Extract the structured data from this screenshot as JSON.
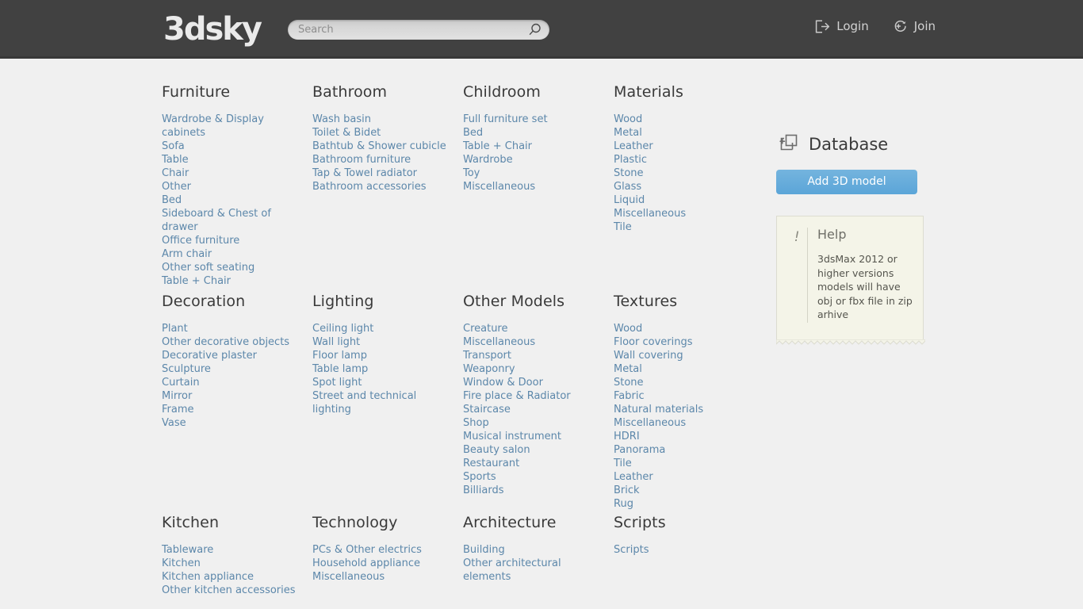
{
  "header": {
    "logo": "3dsky",
    "search": {
      "placeholder": "Search",
      "value": "",
      "icon": "search-icon"
    },
    "auth": [
      {
        "label": "Login",
        "icon": "login-arrow-icon"
      },
      {
        "label": "Join",
        "icon": "join-circle-plus-icon"
      }
    ]
  },
  "sidebar": {
    "database_title": "Database",
    "database_icon": "copy-plus-icon",
    "add_model_label": "Add 3D model",
    "help": {
      "bang": "!",
      "title": "Help",
      "text": "3dsMax 2012 or higher versions models will have obj or fbx file in zip arhive"
    }
  },
  "colors": {
    "header_bg": "#414141",
    "page_bg": "#f0f0f0",
    "link": "#5c87aa",
    "heading": "#3a3a3a",
    "button_accent": "#5ba5d8",
    "help_bg": "#f4f4e8"
  },
  "catalog": {
    "rows": [
      {
        "columns": [
          {
            "title": "Furniture",
            "links": [
              "Wardrobe & Display cabinets",
              "Sofa",
              "Table",
              "Chair",
              "Other",
              "Bed",
              "Sideboard & Chest of drawer",
              "Office furniture",
              "Arm chair",
              "Other soft seating",
              "Table + Chair"
            ]
          },
          {
            "title": "Bathroom",
            "links": [
              "Wash basin",
              "Toilet & Bidet",
              "Bathtub & Shower cubicle",
              "Bathroom furniture",
              "Tap & Towel radiator",
              "Bathroom accessories"
            ]
          },
          {
            "title": "Childroom",
            "links": [
              "Full furniture set",
              "Bed",
              "Table + Chair",
              "Wardrobe",
              "Toy",
              "Miscellaneous"
            ]
          },
          {
            "title": "Materials",
            "links": [
              "Wood",
              "Metal",
              "Leather",
              "Plastic",
              "Stone",
              "Glass",
              "Liquid",
              "Miscellaneous",
              "Tile"
            ]
          }
        ]
      },
      {
        "columns": [
          {
            "title": "Decoration",
            "links": [
              "Plant",
              "Other decorative objects",
              "Decorative plaster",
              "Sculpture",
              "Curtain",
              "Mirror",
              "Frame",
              "Vase"
            ]
          },
          {
            "title": "Lighting",
            "links": [
              "Ceiling light",
              "Wall light",
              "Floor lamp",
              "Table lamp",
              "Spot light",
              "Street and technical lighting"
            ]
          },
          {
            "title": "Other Models",
            "links": [
              "Creature",
              "Miscellaneous",
              "Transport",
              "Weaponry",
              "Window & Door",
              "Fire place & Radiator",
              "Staircase",
              "Shop",
              "Musical instrument",
              "Beauty salon",
              "Restaurant",
              "Sports",
              "Billiards"
            ]
          },
          {
            "title": "Textures",
            "links": [
              "Wood",
              "Floor coverings",
              "Wall covering",
              "Metal",
              "Stone",
              "Fabric",
              "Natural materials",
              "Miscellaneous",
              "HDRI",
              "Panorama",
              "Tile",
              "Leather",
              "Brick",
              "Rug"
            ]
          }
        ]
      },
      {
        "columns": [
          {
            "title": "Kitchen",
            "links": [
              "Tableware",
              "Kitchen",
              "Kitchen appliance",
              "Other kitchen accessories"
            ]
          },
          {
            "title": "Technology",
            "links": [
              "PCs & Other electrics",
              "Household appliance",
              "Miscellaneous"
            ]
          },
          {
            "title": "Architecture",
            "links": [
              "Building",
              "Other architectural elements"
            ]
          },
          {
            "title": "Scripts",
            "links": [
              "Scripts"
            ]
          }
        ]
      }
    ]
  }
}
